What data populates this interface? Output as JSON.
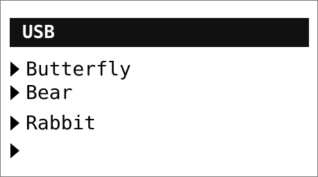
{
  "header": {
    "title": "USB"
  },
  "menu": {
    "items": [
      {
        "label": "Butterfly",
        "icon": "triangle-right-icon"
      },
      {
        "label": "Bear",
        "icon": "triangle-right-icon"
      },
      {
        "label": "Rabbit",
        "icon": "triangle-right-icon"
      },
      {
        "label": "",
        "icon": "triangle-right-icon"
      }
    ]
  },
  "colors": {
    "header_bg": "#111111",
    "header_text": "#ffffff",
    "screen_bg": "#ffffff",
    "text": "#000000"
  }
}
